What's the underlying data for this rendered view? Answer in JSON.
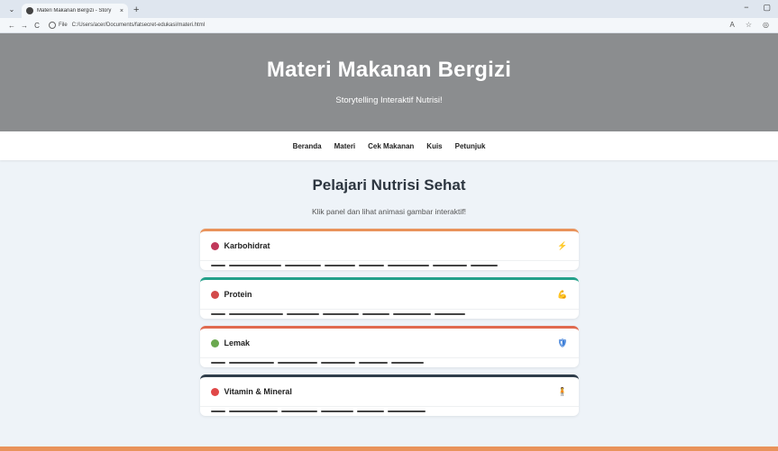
{
  "browser": {
    "tab_title": "Materi Makanan Bergizi - Story",
    "tab_close": "×",
    "new_tab": "+",
    "back": "←",
    "forward": "→",
    "reload": "C",
    "scheme": "File",
    "url": "C:/Users/acer/Documents/fatsecret-edukasi/materi.html",
    "minimize": "−",
    "restore": "▢"
  },
  "header": {
    "title": "Materi Makanan Bergizi",
    "subtitle": "Storytelling Interaktif Nutrisi!"
  },
  "nav": [
    "Beranda",
    "Materi",
    "Cek Makanan",
    "Kuis",
    "Petunjuk"
  ],
  "main": {
    "heading": "Pelajari Nutrisi Sehat",
    "subheading": "Klik panel dan lihat animasi gambar interaktif!"
  },
  "panels": [
    {
      "label": "Karbohidrat",
      "icon": "onion-icon",
      "icon_color": "#c0385a",
      "right_icon": "lightning-icon",
      "right_glyph": "⚡",
      "right_color": "#f0a43a",
      "accent": "#e9935b"
    },
    {
      "label": "Protein",
      "icon": "meat-icon",
      "icon_color": "#d24a4a",
      "right_icon": "muscle-icon",
      "right_glyph": "💪",
      "right_color": "#f0b32a",
      "accent": "#23a08a"
    },
    {
      "label": "Lemak",
      "icon": "avocado-icon",
      "icon_color": "#6aa84f",
      "right_icon": "shield-icon",
      "right_glyph": "🛡",
      "right_color": "#3a7dd8",
      "accent": "#e06a4f"
    },
    {
      "label": "Vitamin & Mineral",
      "icon": "apple-icon",
      "icon_color": "#e04848",
      "right_icon": "person-icon",
      "right_glyph": "🧍",
      "right_color": "#3a5aa8",
      "accent": "#2f3d4a"
    }
  ]
}
